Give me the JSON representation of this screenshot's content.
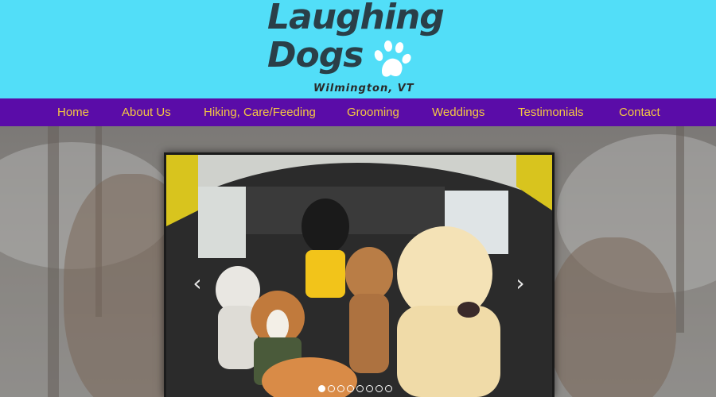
{
  "header": {
    "logo_line1": "Laughing",
    "logo_line2": "Dogs",
    "location": "Wilmington, VT",
    "paw_icon": "paw-print-icon",
    "bg_color": "#52def8",
    "text_color": "#2a3f48"
  },
  "nav": {
    "bg_color": "#5a0ca8",
    "text_color": "#f4c842",
    "items": [
      {
        "label": "Home"
      },
      {
        "label": "About Us"
      },
      {
        "label": "Hiking, Care/Feeding"
      },
      {
        "label": "Grooming"
      },
      {
        "label": "Weddings"
      },
      {
        "label": "Testimonials"
      },
      {
        "label": "Contact"
      }
    ]
  },
  "slideshow": {
    "prev_icon": "chevron-left-icon",
    "next_icon": "chevron-right-icon",
    "prev_glyph": "‹",
    "next_glyph": "›",
    "slide_count": 8,
    "active_slide": 1
  }
}
